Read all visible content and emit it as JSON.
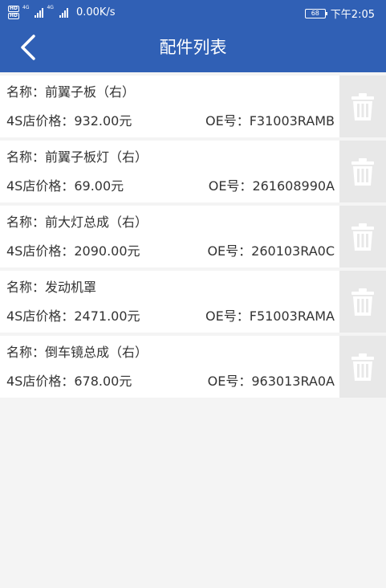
{
  "status_bar": {
    "hd1": "HD",
    "hd2": "HD",
    "net1": "4G",
    "net2": "4G",
    "speed": "0.00K/s",
    "battery": "68",
    "time": "下午2:05"
  },
  "header": {
    "title": "配件列表"
  },
  "labels": {
    "name": "名称：",
    "price": "4S店价格：",
    "oe": "OE号："
  },
  "parts": [
    {
      "name": "前翼子板（右）",
      "price": "932.00元",
      "oe": "F31003RAMB"
    },
    {
      "name": "前翼子板灯（右）",
      "price": "69.00元",
      "oe": "261608990A"
    },
    {
      "name": "前大灯总成（右）",
      "price": "2090.00元",
      "oe": "260103RA0C"
    },
    {
      "name": "发动机罩",
      "price": "2471.00元",
      "oe": "F51003RAMA"
    },
    {
      "name": "倒车镜总成（右）",
      "price": "678.00元",
      "oe": "963013RA0A"
    }
  ]
}
